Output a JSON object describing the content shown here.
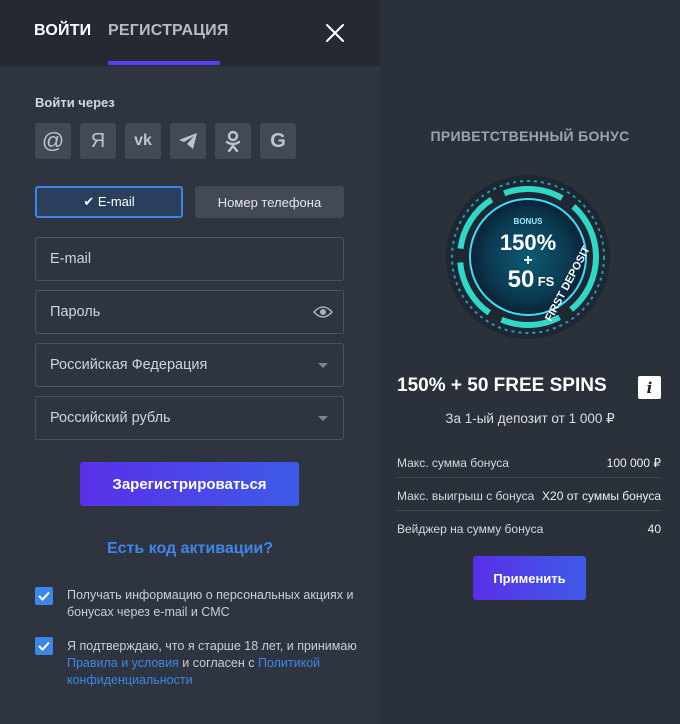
{
  "tabs": {
    "login": "ВОЙТИ",
    "register": "РЕГИСТРАЦИЯ",
    "active": "register"
  },
  "social": {
    "label": "Войти через",
    "providers": [
      {
        "icon": "at-sign-icon",
        "glyph": "@"
      },
      {
        "icon": "yandex-icon",
        "glyph": "Я"
      },
      {
        "icon": "vk-icon",
        "glyph": "vk"
      },
      {
        "icon": "telegram-icon",
        "glyph": ""
      },
      {
        "icon": "odnoklassniki-icon",
        "glyph": ""
      },
      {
        "icon": "google-icon",
        "glyph": "G"
      }
    ]
  },
  "method": {
    "email": "✔ E-mail",
    "phone": "Номер телефона",
    "selected": "email"
  },
  "form": {
    "email_placeholder": "E-mail",
    "password_placeholder": "Пароль",
    "country_value": "Российская Федерация",
    "currency_value": "Российский рубль",
    "submit_label": "Зарегистрироваться",
    "promo_link": "Есть код активации?"
  },
  "consent": {
    "newsletter_checked": true,
    "newsletter_text": "Получать информацию о персональных акциях и бонусах через e-mail и СМС",
    "age_checked": true,
    "age_text_1": "Я подтверждаю, что я старше 18 лет, и принимаю ",
    "rules_link": "Правила и условия",
    "age_text_2": " и согласен с ",
    "privacy_link": "Политикой конфиденциальности"
  },
  "bonus": {
    "title": "ПРИВЕТСТВЕННЫЙ БОНУС",
    "badge_top": "BONUS",
    "badge_main": "150%",
    "badge_plus": "+",
    "badge_fs_num": "50",
    "badge_fs_suffix": "FS",
    "badge_ring": "FIRST DEPOSIT",
    "headline": "150% + 50 FREE SPINS",
    "info_glyph": "i",
    "subline": "За 1-ый депозит от 1 000 ₽",
    "rows": [
      {
        "key": "Макс. сумма бонуса",
        "value": "100 000 ₽"
      },
      {
        "key": "Макс. выигрыш с бонуса",
        "value": "X20 от суммы бонуса"
      },
      {
        "key": "Вейджер на сумму бонуса",
        "value": "40"
      }
    ],
    "apply_label": "Применить"
  },
  "colors": {
    "accent_blue": "#3d86e8",
    "accent_purple": "#5a2fe8",
    "badge_teal": "#2fd9c8"
  }
}
